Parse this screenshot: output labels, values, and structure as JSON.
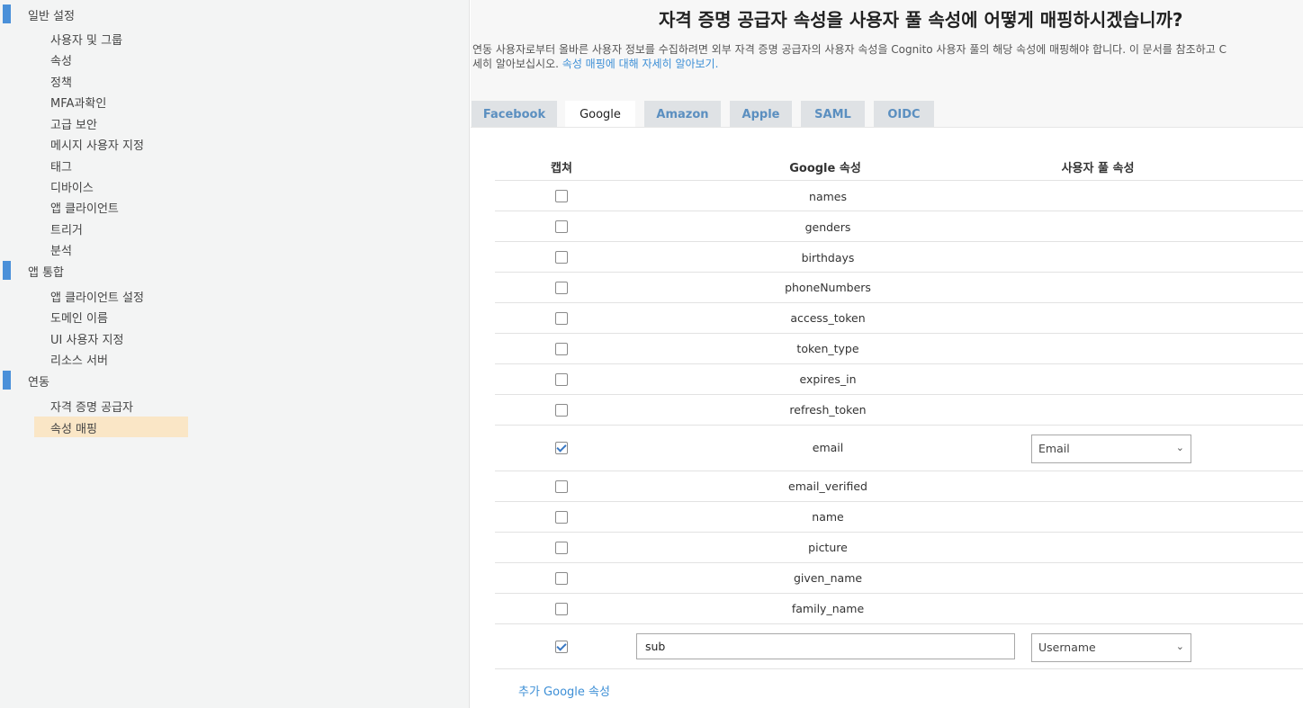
{
  "sidebar": {
    "sections": [
      {
        "label": "일반 설정",
        "items": [
          "사용자 및 그룹",
          "속성",
          "정책",
          "MFA과확인",
          "고급 보안",
          "메시지 사용자 지정",
          "태그",
          "디바이스",
          "앱 클라이언트",
          "트리거",
          "분석"
        ]
      },
      {
        "label": "앱 통합",
        "items": [
          "앱 클라이언트 설정",
          "도메인 이름",
          "UI 사용자 지정",
          "리소스 서버"
        ]
      },
      {
        "label": "연동",
        "items": [
          "자격 증명 공급자",
          "속성 매핑"
        ]
      }
    ],
    "active_item": "속성 매핑",
    "accent_color": "#4a90d9",
    "active_bg": "#fae6c6"
  },
  "main": {
    "heading": "자격 증명 공급자 속성을 사용자 풀 속성에 어떻게 매핑하시겠습니까?",
    "description": "연동 사용자로부터 올바른 사용자 정보를 수집하려면 외부 자격 증명 공급자의 사용자 속성을 Cognito 사용자 풀의 해당 속성에 매핑해야 합니다. 이 문서를 참조하고 C",
    "description_line2": "세히 알아보십시오.",
    "description_link": "속성 매핑에 대해 자세히 알아보기.",
    "tabs": [
      "Facebook",
      "Google",
      "Amazon",
      "Apple",
      "SAML",
      "OIDC"
    ],
    "active_tab": "Google",
    "table": {
      "headers": {
        "capture": "캡쳐",
        "provider_attr": "Google 속성",
        "pool_attr": "사용자 풀 속성"
      },
      "rows": [
        {
          "attr": "names",
          "checked": false
        },
        {
          "attr": "genders",
          "checked": false
        },
        {
          "attr": "birthdays",
          "checked": false
        },
        {
          "attr": "phoneNumbers",
          "checked": false
        },
        {
          "attr": "access_token",
          "checked": false
        },
        {
          "attr": "token_type",
          "checked": false
        },
        {
          "attr": "expires_in",
          "checked": false
        },
        {
          "attr": "refresh_token",
          "checked": false
        },
        {
          "attr": "email",
          "checked": true,
          "mapped_to": "Email"
        },
        {
          "attr": "email_verified",
          "checked": false
        },
        {
          "attr": "name",
          "checked": false
        },
        {
          "attr": "picture",
          "checked": false
        },
        {
          "attr": "given_name",
          "checked": false
        },
        {
          "attr": "family_name",
          "checked": false
        }
      ],
      "custom_row": {
        "checked": true,
        "value": "sub",
        "mapped_to": "Username"
      }
    },
    "add_link": "추가 Google 속성"
  }
}
